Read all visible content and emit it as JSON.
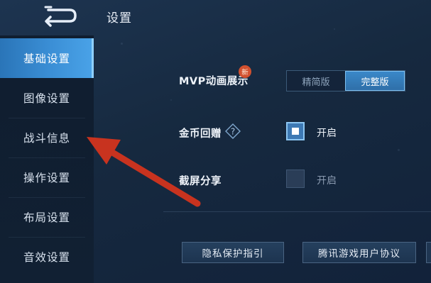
{
  "header": {
    "title": "设置",
    "back_icon": "back-arrow-icon"
  },
  "sidebar": {
    "items": [
      {
        "label": "基础设置",
        "active": true
      },
      {
        "label": "图像设置",
        "active": false
      },
      {
        "label": "战斗信息",
        "active": false
      },
      {
        "label": "操作设置",
        "active": false
      },
      {
        "label": "布局设置",
        "active": false
      },
      {
        "label": "音效设置",
        "active": false
      }
    ]
  },
  "settings": {
    "mvp": {
      "label": "MVP动画展示",
      "badge": "新",
      "options": [
        "精简版",
        "完整版"
      ],
      "selected": "完整版"
    },
    "coin_gift": {
      "label": "金币回赠",
      "help_icon": "question-diamond-icon",
      "checkbox_label": "开启",
      "checked": true
    },
    "screenshot_share": {
      "label": "截屏分享",
      "checkbox_label": "开启",
      "checked": false
    }
  },
  "footer": {
    "privacy_button": "隐私保护指引",
    "agreement_button": "腾讯游戏用户协议"
  },
  "colors": {
    "accent": "#3b8fd6",
    "annotation_arrow": "#d0362a",
    "badge": "#d2512f"
  }
}
